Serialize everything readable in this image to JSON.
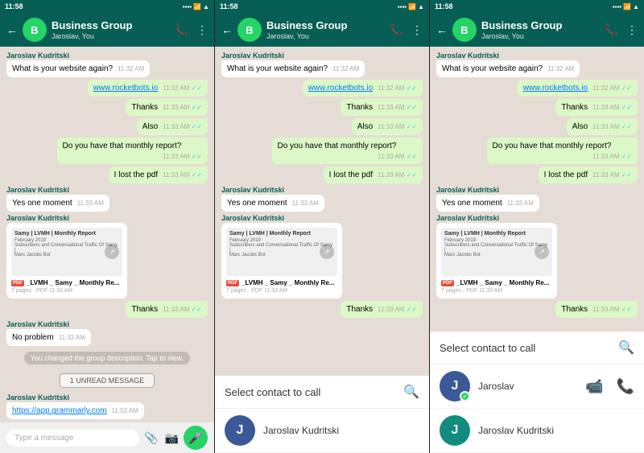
{
  "panels": [
    {
      "id": "panel1",
      "status_bar": {
        "time": "11:58",
        "icons": "🔔 📷 ⬛ 📶 📶 🔋"
      },
      "header": {
        "title": "Business Group",
        "subtitle": "Jaroslav, You",
        "back": "←",
        "icons": [
          "📞",
          "⋮"
        ]
      },
      "messages": [
        {
          "type": "received",
          "sender": "Jaroslav Kudritski",
          "text": "What is your website again?",
          "time": "11:32 AM",
          "ticks": ""
        },
        {
          "type": "sent",
          "text": "www.rocketbots.io",
          "time": "11:32 AM",
          "ticks": "✓✓",
          "link": true
        },
        {
          "type": "sent",
          "text": "Thanks",
          "time": "11:33 AM",
          "ticks": "✓✓"
        },
        {
          "type": "sent",
          "text": "Also",
          "time": "11:33 AM",
          "ticks": "✓✓"
        },
        {
          "type": "sent",
          "text": "Do you have that monthly report?",
          "time": "11:33 AM",
          "ticks": "✓✓"
        },
        {
          "type": "sent",
          "text": "I lost the pdf",
          "time": "11:33 AM",
          "ticks": "✓✓"
        },
        {
          "type": "received",
          "sender": "Jaroslav Kudritski",
          "text": "Yes one moment",
          "time": "11:33 AM",
          "ticks": ""
        },
        {
          "type": "received_doc",
          "sender": "Jaroslav Kudritski",
          "doc_title": "Samy | LVMH | Monthly Report",
          "doc_sub1": "February 2019",
          "doc_sub2": "Subscribers and Conversational Traffic Of Samy |",
          "doc_sub3": "Marc Jacobs Bot",
          "filename": "_LVMH _ Samy _ Monthly Re...",
          "meta": "7 pages · PDF",
          "time": "11:33 AM"
        },
        {
          "type": "sent",
          "text": "Thanks",
          "time": "11:33 AM",
          "ticks": "✓✓"
        },
        {
          "type": "received",
          "sender": "Jaroslav Kudritski",
          "text": "No problem",
          "time": "11:33 AM",
          "ticks": ""
        },
        {
          "type": "system",
          "text": "You changed the group description. Tap to view."
        },
        {
          "type": "unread",
          "text": "1 UNREAD MESSAGE"
        },
        {
          "type": "received",
          "sender": "Jaroslav Kudritski",
          "text": "https://app.grammarly.com",
          "time": "11:52 AM",
          "link": true
        }
      ],
      "input": {
        "placeholder": "Type a message",
        "icons": [
          "📎",
          "📷"
        ],
        "mic": "🎤"
      },
      "show_overlay": false
    },
    {
      "id": "panel2",
      "status_bar": {
        "time": "11:58",
        "icons": "🔔 📷 ⬛ 📶 📶 🔋"
      },
      "header": {
        "title": "Business Group",
        "subtitle": "Jaroslav, You",
        "back": "←",
        "icons": [
          "📞",
          "⋮"
        ]
      },
      "messages": [
        {
          "type": "received",
          "sender": "Jaroslav Kudritski",
          "text": "What is your website again?",
          "time": "11:32 AM",
          "ticks": ""
        },
        {
          "type": "sent",
          "text": "www.rocketbots.io",
          "time": "11:32 AM",
          "ticks": "✓✓",
          "link": true
        },
        {
          "type": "sent",
          "text": "Thanks",
          "time": "11:33 AM",
          "ticks": "✓✓"
        },
        {
          "type": "sent",
          "text": "Also",
          "time": "11:33 AM",
          "ticks": "✓✓"
        },
        {
          "type": "sent",
          "text": "Do you have that monthly report?",
          "time": "11:33 AM",
          "ticks": "✓✓"
        },
        {
          "type": "sent",
          "text": "I lost the pdf",
          "time": "11:33 AM",
          "ticks": "✓✓"
        },
        {
          "type": "received",
          "sender": "Jaroslav Kudritski",
          "text": "Yes one moment",
          "time": "11:33 AM",
          "ticks": ""
        },
        {
          "type": "received_doc",
          "sender": "Jaroslav Kudritski",
          "doc_title": "Samy | LVMH | Monthly Report",
          "doc_sub1": "February 2019",
          "doc_sub2": "Subscribers and Conversational Traffic Of Samy |",
          "doc_sub3": "Marc Jacobs Bot",
          "filename": "_LVMH _ Samy _ Monthly Re...",
          "meta": "7 pages · PDF",
          "time": "11:33 AM"
        },
        {
          "type": "sent",
          "text": "Thanks",
          "time": "11:33 AM",
          "ticks": "✓✓"
        }
      ],
      "show_overlay": true,
      "overlay": {
        "title": "Select contact to call",
        "contacts": [
          {
            "name": "Jaroslav Kudritski",
            "avatar_letter": "J",
            "avatar_color": "blue",
            "has_check": false,
            "actions": []
          }
        ]
      }
    },
    {
      "id": "panel3",
      "status_bar": {
        "time": "11:58",
        "icons": "🔔 📷 ⬛ 📶 📶 🔋"
      },
      "header": {
        "title": "Business Group",
        "subtitle": "Jaroslav, You",
        "back": "←",
        "icons": [
          "📞",
          "⋮"
        ]
      },
      "messages": [
        {
          "type": "received",
          "sender": "Jaroslav Kudritski",
          "text": "What is your website again?",
          "time": "11:32 AM",
          "ticks": ""
        },
        {
          "type": "sent",
          "text": "www.rocketbots.io",
          "time": "11:32 AM",
          "ticks": "✓✓",
          "link": true
        },
        {
          "type": "sent",
          "text": "Thanks",
          "time": "11:33 AM",
          "ticks": "✓✓"
        },
        {
          "type": "sent",
          "text": "Also",
          "time": "11:33 AM",
          "ticks": "✓✓"
        },
        {
          "type": "sent",
          "text": "Do you have that monthly report?",
          "time": "11:33 AM",
          "ticks": "✓✓"
        },
        {
          "type": "sent",
          "text": "I lost the pdf",
          "time": "11:33 AM",
          "ticks": "✓✓"
        },
        {
          "type": "received",
          "sender": "Jaroslav Kudritski",
          "text": "Yes one moment",
          "time": "11:33 AM",
          "ticks": ""
        },
        {
          "type": "received_doc",
          "sender": "Jaroslav Kudritski",
          "doc_title": "Samy | LVMH | Monthly Report",
          "doc_sub1": "February 2019",
          "doc_sub2": "Subscribers and Conversational Traffic Of Samy |",
          "doc_sub3": "Marc Jacobs Bot",
          "filename": "_LVMH _ Samy _ Monthly Re...",
          "meta": "7 pages · PDF",
          "time": "11:33 AM"
        },
        {
          "type": "sent",
          "text": "Thanks",
          "time": "11:33 AM",
          "ticks": "✓✓"
        }
      ],
      "show_overlay": true,
      "overlay": {
        "title": "Select contact to call",
        "contacts": [
          {
            "name": "Jaroslav",
            "avatar_letter": "J",
            "avatar_color": "blue",
            "has_check": true,
            "actions": [
              "📹",
              "📞"
            ]
          },
          {
            "name": "Jaroslav Kudritski",
            "avatar_letter": "J",
            "avatar_color": "teal2",
            "has_check": false,
            "actions": []
          }
        ]
      }
    }
  ]
}
